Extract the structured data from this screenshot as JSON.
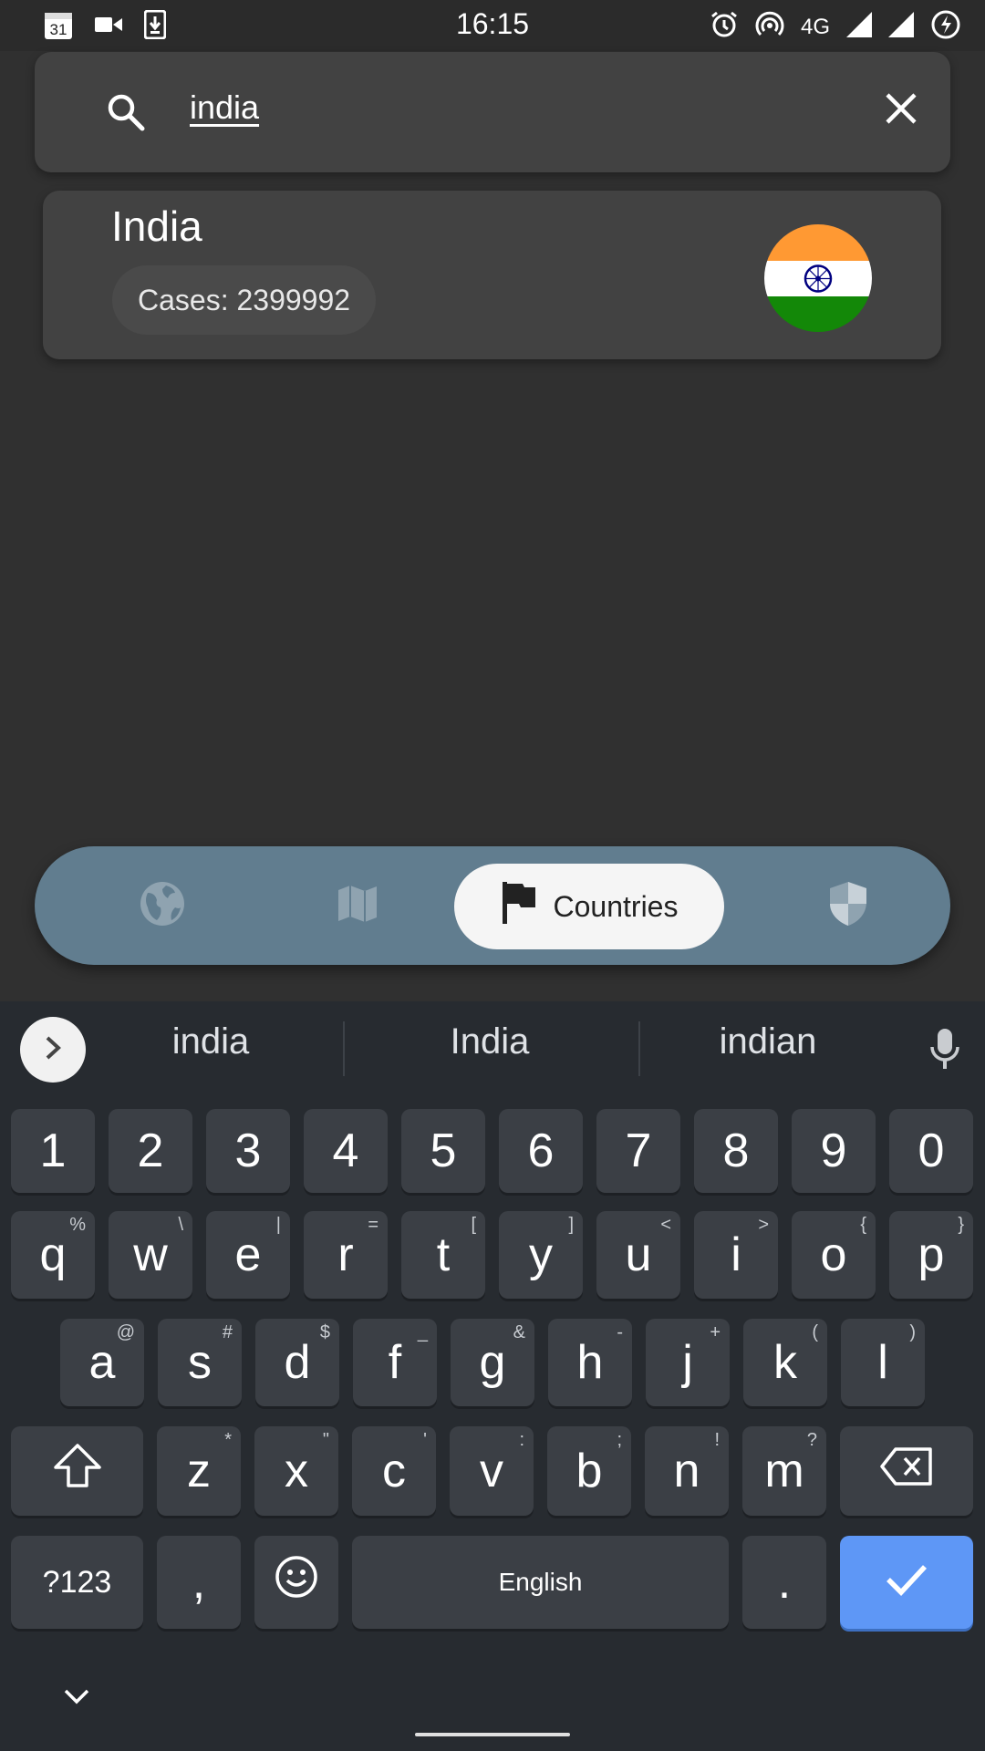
{
  "status_bar": {
    "time": "16:15",
    "network": "4G",
    "left_icons": [
      "calendar-icon",
      "video-camera-icon",
      "download-icon"
    ],
    "calendar_day": "31",
    "right_icons": [
      "alarm-icon",
      "hotspot-icon",
      "signal-icon",
      "signal-icon",
      "battery-saver-icon"
    ]
  },
  "search": {
    "query": "india"
  },
  "results": [
    {
      "country": "India",
      "cases_text": "Cases: 2399992"
    }
  ],
  "bottom_nav": {
    "items": [
      {
        "icon": "globe-icon"
      },
      {
        "icon": "map-icon"
      },
      {
        "icon": "flag-icon",
        "label": "Countries",
        "active": true
      },
      {
        "icon": "shield-icon"
      }
    ],
    "color": "#617d8f"
  },
  "keyboard": {
    "suggestions": [
      "india",
      "India",
      "indian"
    ],
    "number_row": [
      "1",
      "2",
      "3",
      "4",
      "5",
      "6",
      "7",
      "8",
      "9",
      "0"
    ],
    "row1": [
      {
        "k": "q",
        "a": "%"
      },
      {
        "k": "w",
        "a": "\\"
      },
      {
        "k": "e",
        "a": "|"
      },
      {
        "k": "r",
        "a": "="
      },
      {
        "k": "t",
        "a": "["
      },
      {
        "k": "y",
        "a": "]"
      },
      {
        "k": "u",
        "a": "<"
      },
      {
        "k": "i",
        "a": ">"
      },
      {
        "k": "o",
        "a": "{"
      },
      {
        "k": "p",
        "a": "}"
      }
    ],
    "row2": [
      {
        "k": "a",
        "a": "@"
      },
      {
        "k": "s",
        "a": "#"
      },
      {
        "k": "d",
        "a": "$"
      },
      {
        "k": "f",
        "a": "_"
      },
      {
        "k": "g",
        "a": "&"
      },
      {
        "k": "h",
        "a": "-"
      },
      {
        "k": "j",
        "a": "+"
      },
      {
        "k": "k",
        "a": "("
      },
      {
        "k": "l",
        "a": ")"
      }
    ],
    "row3": [
      {
        "k": "z",
        "a": "*"
      },
      {
        "k": "x",
        "a": "\""
      },
      {
        "k": "c",
        "a": "'"
      },
      {
        "k": "v",
        "a": ":"
      },
      {
        "k": "b",
        "a": ";"
      },
      {
        "k": "n",
        "a": "!"
      },
      {
        "k": "m",
        "a": "?"
      }
    ],
    "symbols_label": "?123",
    "comma": ",",
    "space_label": "English",
    "period": ".",
    "enter_color": "#5e97f6"
  }
}
